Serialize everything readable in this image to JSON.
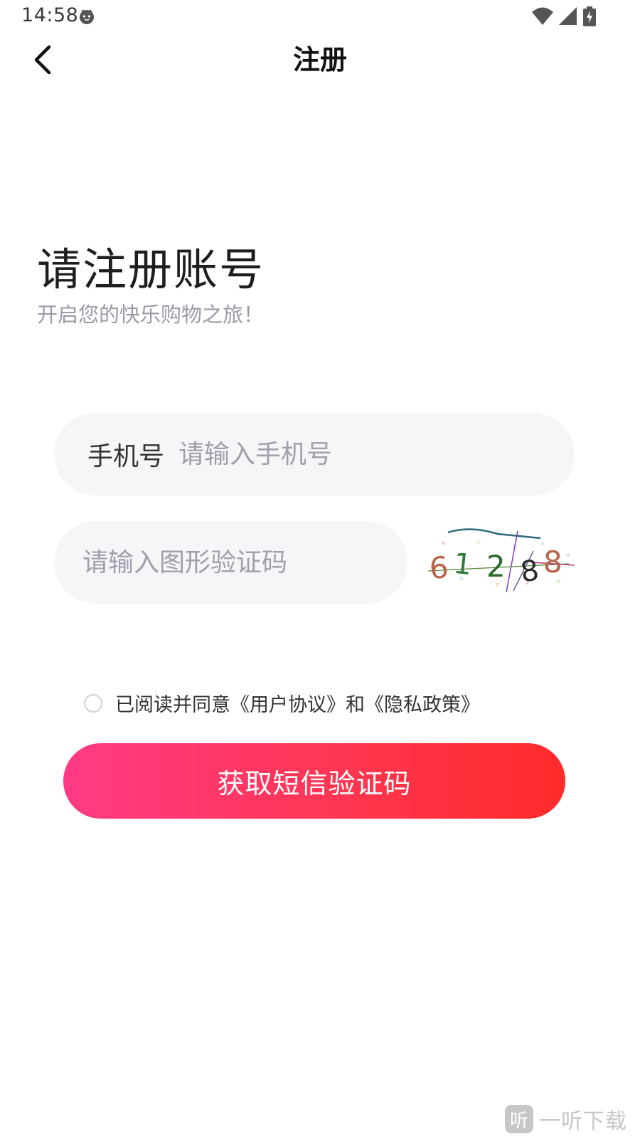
{
  "status_bar": {
    "time": "14:58",
    "face_icon": "cat-face-icon",
    "wifi_icon": "wifi-icon",
    "signal_icon": "cell-signal-icon",
    "battery_icon": "battery-charging-icon"
  },
  "nav": {
    "back_icon": "chevron-left-icon",
    "title": "注册"
  },
  "heading": {
    "title": "请注册账号",
    "subtitle": "开启您的快乐购物之旅！"
  },
  "form": {
    "phone_label": "手机号",
    "phone_placeholder": "请输入手机号",
    "phone_value": "",
    "captcha_placeholder": "请输入图形验证码",
    "captcha_value": "",
    "captcha_image_digits": [
      "6",
      "1",
      "2",
      "8",
      "8"
    ]
  },
  "agreement": {
    "checked": false,
    "prefix": "已阅读并同意",
    "user_agreement": "《用户协议》",
    "conjunction": "和",
    "privacy_policy": "《隐私政策》"
  },
  "submit": {
    "label": "获取短信验证码"
  },
  "watermark": {
    "logo_char": "听",
    "text": "一听下载"
  },
  "colors": {
    "gradient_start": "#ff3a86",
    "gradient_end": "#ff2a2a",
    "field_bg": "#f6f6f8",
    "placeholder": "#a0a0ac"
  }
}
